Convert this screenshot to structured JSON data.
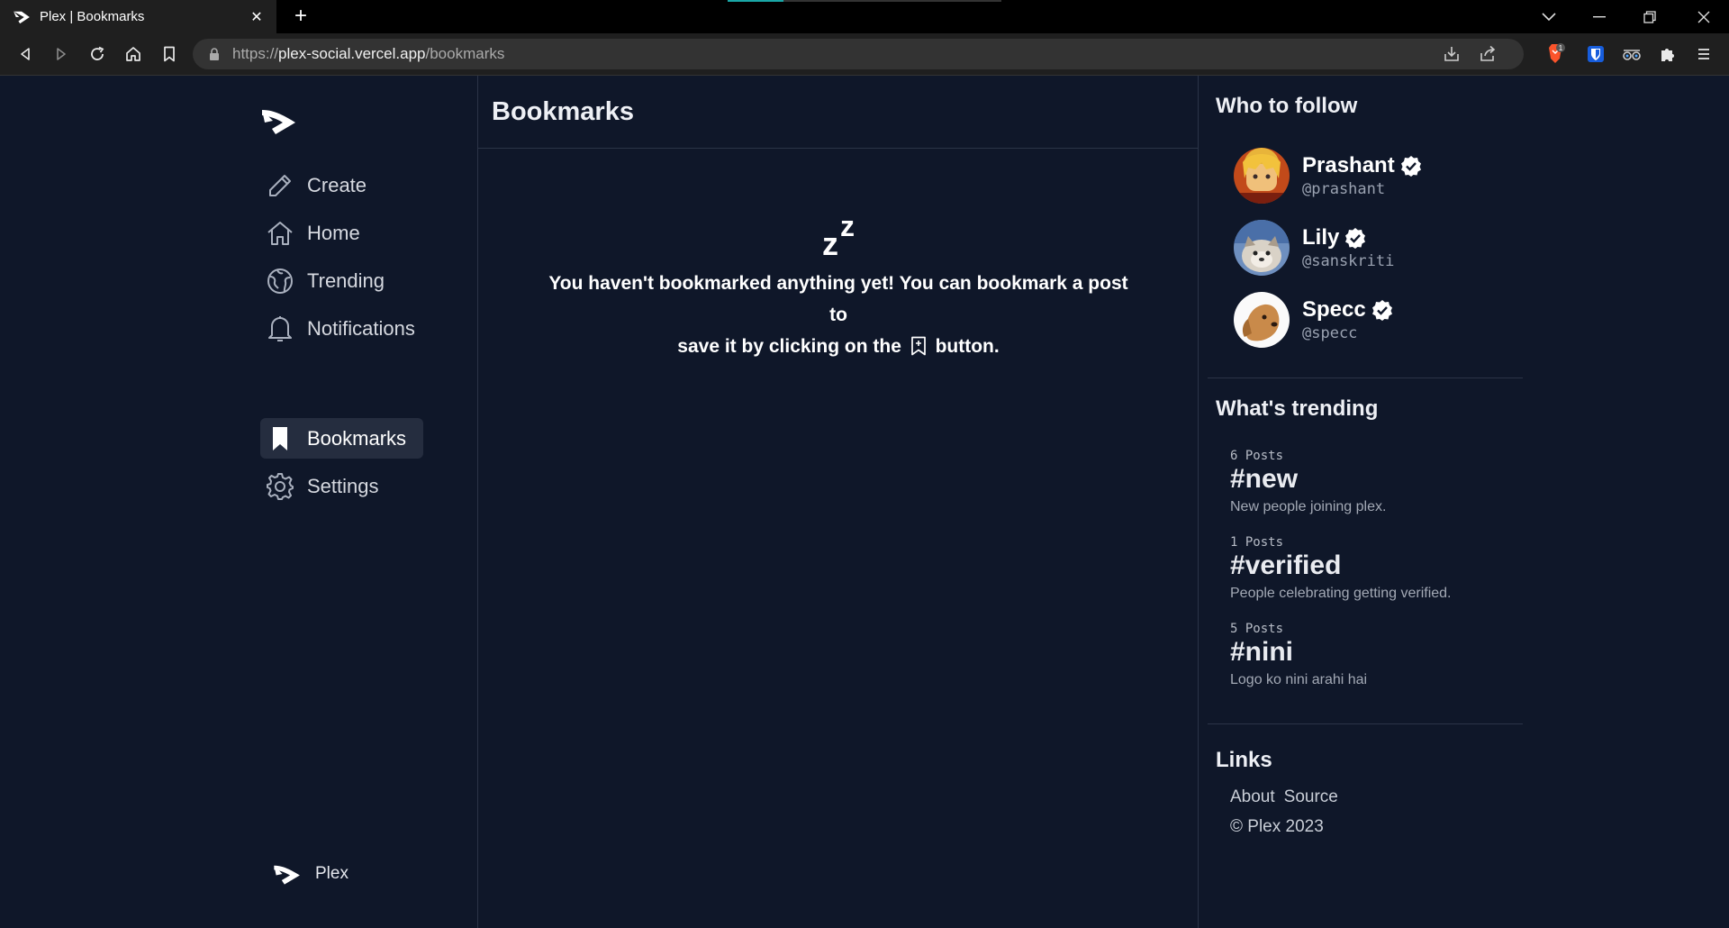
{
  "browser": {
    "tab_title": "Plex | Bookmarks",
    "tab_close": "✕",
    "new_tab": "+",
    "url_scheme": "https://",
    "url_host": "plex-social.vercel.app",
    "url_path": "/bookmarks",
    "brave_badge": "1"
  },
  "sidebar": {
    "items": [
      {
        "label": "Create",
        "icon": "pencil-icon"
      },
      {
        "label": "Home",
        "icon": "home-icon"
      },
      {
        "label": "Trending",
        "icon": "globe-icon"
      },
      {
        "label": "Notifications",
        "icon": "bell-icon"
      },
      {
        "label": "Bookmarks",
        "icon": "bookmark-icon",
        "active": true
      },
      {
        "label": "Settings",
        "icon": "gear-icon"
      }
    ],
    "footer_label": "Plex"
  },
  "main": {
    "title": "Bookmarks",
    "empty_icon_z1": "z",
    "empty_icon_z2": "z",
    "empty_line1": "You haven't bookmarked anything yet! You can bookmark a post to",
    "empty_line2_before": "save it by clicking on the",
    "empty_line2_after": "button."
  },
  "who_to_follow": {
    "title": "Who to follow",
    "users": [
      {
        "name": "Prashant",
        "handle": "@prashant"
      },
      {
        "name": "Lily",
        "handle": "@sanskriti"
      },
      {
        "name": "Specc",
        "handle": "@specc"
      }
    ]
  },
  "trending": {
    "title": "What's trending",
    "items": [
      {
        "count": "6 Posts",
        "tag": "#new",
        "desc": "New people joining plex."
      },
      {
        "count": "1 Posts",
        "tag": "#verified",
        "desc": "People celebrating getting verified."
      },
      {
        "count": "5 Posts",
        "tag": "#nini",
        "desc": "Logo ko nini arahi hai"
      }
    ]
  },
  "links": {
    "title": "Links",
    "about": "About",
    "source": "Source",
    "copyright": "©  Plex 2023"
  },
  "colors": {
    "background": "#0f1729",
    "active_nav": "#252d3f",
    "divider": "#2b3447"
  }
}
